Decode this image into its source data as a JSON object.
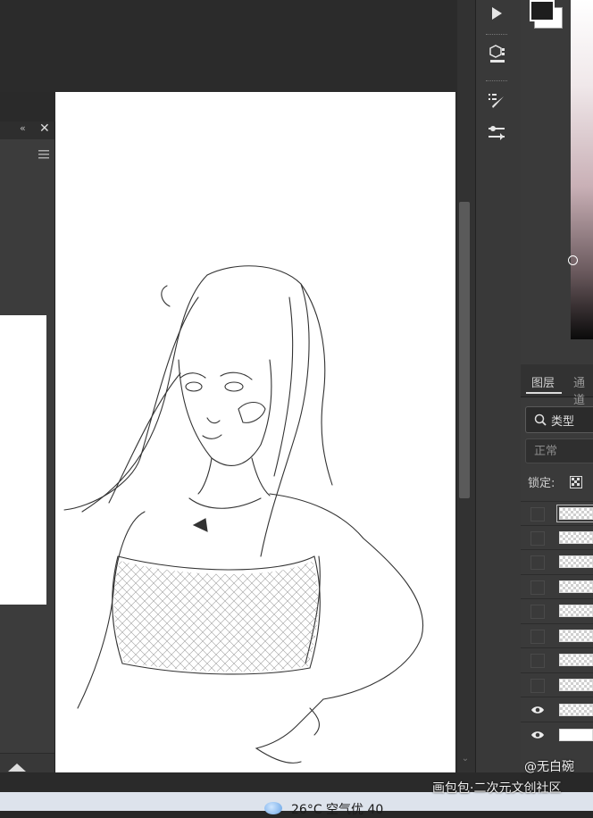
{
  "layers_panel": {
    "tab_layers": "图层",
    "tab_channels": "通道",
    "filter_label": "类型",
    "blend_mode": "正常",
    "lock_label": "锁定:",
    "rows": [
      {
        "visible": false,
        "thumb": "transparent",
        "selected": true
      },
      {
        "visible": false,
        "thumb": "transparent"
      },
      {
        "visible": false,
        "thumb": "transparent"
      },
      {
        "visible": false,
        "thumb": "transparent"
      },
      {
        "visible": false,
        "thumb": "transparent"
      },
      {
        "visible": false,
        "thumb": "transparent"
      },
      {
        "visible": false,
        "thumb": "transparent"
      },
      {
        "visible": false,
        "thumb": "transparent"
      },
      {
        "visible": true,
        "thumb": "transparent"
      },
      {
        "visible": true,
        "thumb": "white"
      }
    ]
  },
  "left_panel": {
    "collapse_icon": "double-chevron-left-icon",
    "close_label": "✕"
  },
  "taskbar": {
    "weather_text": "26°C  空气优 40"
  },
  "watermark": {
    "author": "@无白碗",
    "site": "画包包·二次元文创社区"
  },
  "colors": {
    "foreground": "#1d1d1d",
    "background": "#ffffff",
    "ui_dark": "#282828",
    "panel": "#3a3a3a"
  },
  "toolbar_icons": [
    "play-icon",
    "3d-cube-icon",
    "brush-presets-icon",
    "adjustments-icon"
  ]
}
